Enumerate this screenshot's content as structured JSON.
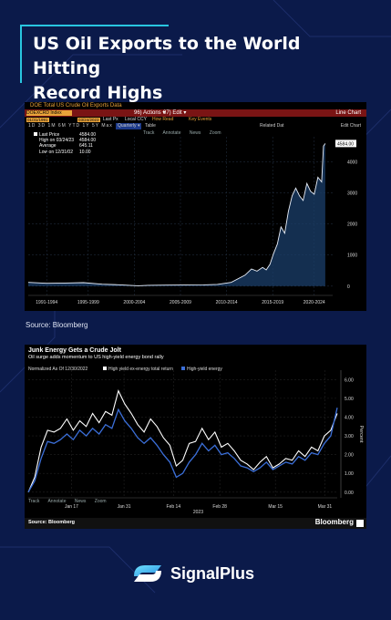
{
  "title": "US Oil Exports to the World Hitting Record Highs",
  "title_line1": "US Oil Exports to the World Hitting",
  "title_line2": "Record Highs",
  "chart1": {
    "header_text": "DOE Total US Crude Oil Exports Data",
    "ticker": "DOEXCRD Index",
    "actions": "96) Actions ▾",
    "edit": "97) Edit ▾",
    "line_chart": "Line Chart",
    "date_start": "01/31/1991",
    "date_end": "03/24/2023",
    "last_price": "Last Px",
    "local_ccy": "Local CCY",
    "how_read": "How Read",
    "key_events": "Key Events",
    "periods": "1D 3D 1M 6M YTD 1Y 5Y Max",
    "frequency": "Quarterly ▾",
    "table": "Table",
    "related_dat": "Related Dat",
    "edit_chart": "Edit Chart",
    "tools": [
      "Track",
      "Annotate",
      "News",
      "Zoom"
    ],
    "legend": [
      {
        "label": "Last Price",
        "value": "4584.00"
      },
      {
        "label": "High on 03/24/23",
        "value": "4584.00"
      },
      {
        "label": "Average",
        "value": "645.11"
      },
      {
        "label": "Low on 12/31/02",
        "value": "10.00"
      }
    ],
    "last_label": "4584.00",
    "yticks": [
      "4000",
      "3000",
      "2000",
      "1000",
      "0"
    ],
    "xticks": [
      "1991-1994",
      "1995-1999",
      "2000-2004",
      "2005-2009",
      "2010-2014",
      "2015-2019",
      "2020-2024"
    ],
    "source": "Source:  Bloomberg"
  },
  "chart1_data": {
    "type": "area",
    "x": [
      1991.0,
      1993.0,
      1995.0,
      1997.0,
      1999.0,
      2001.0,
      2002.9,
      2004.0,
      2006.0,
      2008.0,
      2010.0,
      2011.5,
      2013.0,
      2014.5,
      2015.2,
      2015.8,
      2016.4,
      2016.8,
      2017.2,
      2017.6,
      2018.0,
      2018.4,
      2018.8,
      2019.2,
      2019.6,
      2020.0,
      2020.4,
      2020.8,
      2021.2,
      2021.6,
      2022.0,
      2022.4,
      2022.8,
      2023.0,
      2023.2
    ],
    "values": [
      120,
      90,
      100,
      110,
      60,
      40,
      10,
      25,
      30,
      35,
      40,
      55,
      120,
      350,
      550,
      480,
      600,
      520,
      700,
      1050,
      1350,
      1900,
      1700,
      2400,
      2900,
      3150,
      2900,
      2750,
      3300,
      3050,
      2950,
      3500,
      3350,
      4500,
      4584
    ],
    "ylim": [
      -300,
      4800
    ]
  },
  "chart2": {
    "title": "Junk Energy Gets a Crude Jolt",
    "subtitle": "Oil surge adds momentum to US high-yield energy bond rally",
    "normalized": "Normalized As Of 12/30/2022",
    "series_a_label": "High yield ex-energy total return",
    "series_b_label": "High-yield energy",
    "yticks": [
      "6.00",
      "5.00",
      "4.00",
      "3.00",
      "2.00",
      "1.00",
      "0.00"
    ],
    "ylabel": "Percent",
    "xticks": [
      "Jan 17",
      "Jan 31",
      "Feb 14",
      "Feb 28",
      "Mar 15",
      "Mar 31"
    ],
    "year": "2023",
    "tools": [
      "Track",
      "Annotate",
      "News",
      "Zoom"
    ],
    "source": "Source: Bloomberg",
    "brand": "Bloomberg"
  },
  "chart2_data": {
    "type": "line",
    "ylim": [
      -0.3,
      6.5
    ],
    "series": [
      {
        "name": "High yield ex-energy total return",
        "color": "#ffffff",
        "values": [
          0.0,
          0.8,
          2.4,
          3.3,
          3.2,
          3.4,
          3.9,
          3.3,
          3.8,
          3.5,
          4.2,
          3.7,
          4.3,
          4.1,
          5.4,
          4.7,
          4.2,
          3.6,
          3.2,
          3.9,
          3.5,
          2.9,
          2.5,
          1.4,
          1.7,
          2.6,
          2.7,
          3.4,
          2.8,
          3.2,
          2.4,
          2.6,
          2.2,
          1.7,
          1.5,
          1.2,
          1.6,
          1.9,
          1.3,
          1.5,
          1.8,
          1.7,
          2.2,
          1.9,
          2.4,
          2.2,
          3.0,
          3.3,
          4.2
        ]
      },
      {
        "name": "High-yield energy",
        "color": "#3b6fd9",
        "values": [
          0.0,
          0.6,
          1.8,
          2.7,
          2.6,
          2.8,
          3.1,
          2.8,
          3.3,
          3.0,
          3.4,
          3.1,
          3.6,
          3.4,
          4.4,
          3.8,
          3.4,
          2.9,
          2.6,
          2.9,
          2.5,
          2.0,
          1.6,
          0.8,
          1.0,
          1.6,
          2.0,
          2.6,
          2.2,
          2.5,
          2.0,
          2.1,
          1.8,
          1.4,
          1.3,
          1.1,
          1.3,
          1.6,
          1.2,
          1.4,
          1.6,
          1.5,
          1.9,
          1.7,
          2.1,
          2.0,
          2.6,
          3.0,
          4.5
        ]
      }
    ]
  },
  "logo_text": "SignalPlus",
  "colors": {
    "background": "#0b1a4a",
    "accent": "#29c6e0",
    "bloomberg_orange": "#e9a33a",
    "series_blue": "#3b6fd9"
  }
}
